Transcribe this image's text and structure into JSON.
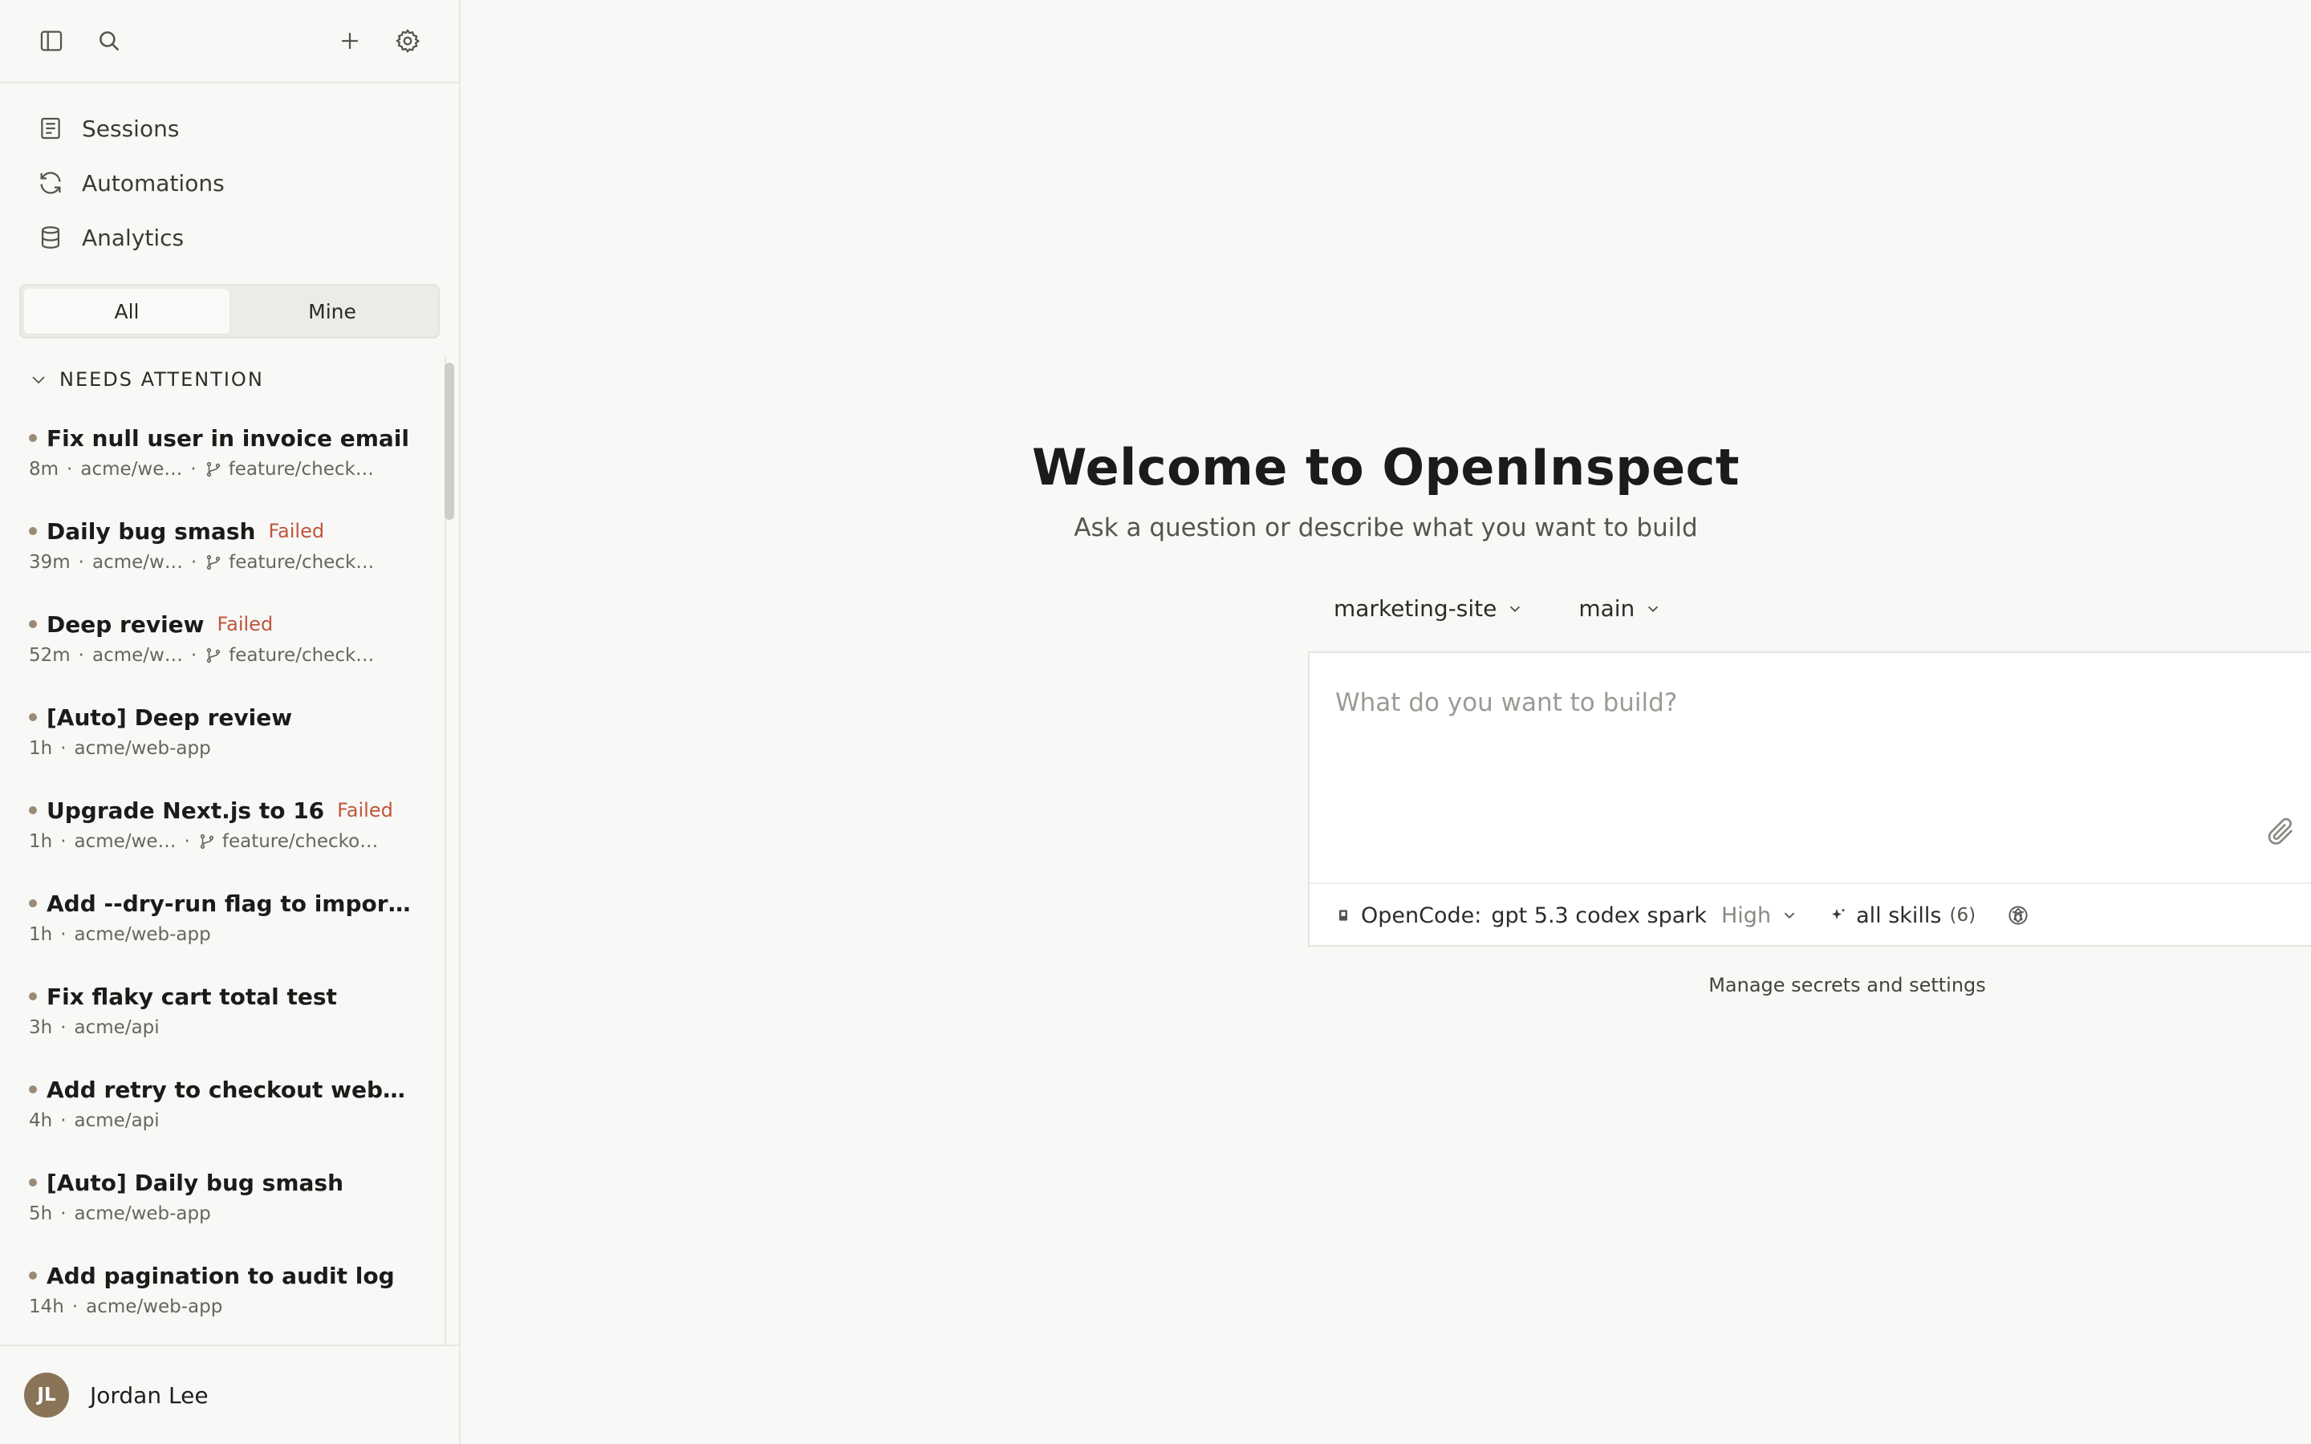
{
  "sidebar": {
    "nav": [
      {
        "label": "Sessions",
        "icon": "document-icon"
      },
      {
        "label": "Automations",
        "icon": "refresh-icon"
      },
      {
        "label": "Analytics",
        "icon": "database-icon"
      }
    ],
    "filter": {
      "all": "All",
      "mine": "Mine",
      "selected": "All"
    },
    "section_title": "NEEDS ATTENTION",
    "sessions": [
      {
        "title": "Fix null user in invoice email",
        "badge": "",
        "time": "8m",
        "repo": "acme/we…",
        "branch": "feature/check…"
      },
      {
        "title": "Daily bug smash",
        "badge": "Failed",
        "time": "39m",
        "repo": "acme/w…",
        "branch": "feature/check…"
      },
      {
        "title": "Deep review",
        "badge": "Failed",
        "time": "52m",
        "repo": "acme/w…",
        "branch": "feature/check…"
      },
      {
        "title": "[Auto] Deep review",
        "badge": "",
        "time": "1h",
        "repo": "acme/web-app",
        "branch": ""
      },
      {
        "title": "Upgrade Next.js to 16",
        "badge": "Failed",
        "time": "1h",
        "repo": "acme/we…",
        "branch": "feature/checko…"
      },
      {
        "title": "Add --dry-run flag to impor…",
        "badge": "",
        "time": "1h",
        "repo": "acme/web-app",
        "branch": ""
      },
      {
        "title": "Fix flaky cart total test",
        "badge": "",
        "time": "3h",
        "repo": "acme/api",
        "branch": ""
      },
      {
        "title": "Add retry to checkout web…",
        "badge": "",
        "time": "4h",
        "repo": "acme/api",
        "branch": ""
      },
      {
        "title": "[Auto] Daily bug smash",
        "badge": "",
        "time": "5h",
        "repo": "acme/web-app",
        "branch": ""
      },
      {
        "title": "Add pagination to audit log",
        "badge": "",
        "time": "14h",
        "repo": "acme/web-app",
        "branch": ""
      }
    ],
    "user": {
      "initials": "JL",
      "name": "Jordan Lee"
    }
  },
  "main": {
    "title": "Welcome to OpenInspect",
    "subtitle": "Ask a question or describe what you want to build",
    "repo": "marketing-site",
    "branch": "main",
    "composer": {
      "placeholder": "What do you want to build?",
      "value": "",
      "model_label": "OpenCode:",
      "model_name": "gpt 5.3 codex spark",
      "model_level": "High",
      "skills_label": "all skills",
      "skills_count": "(6)"
    },
    "manage_link": "Manage secrets and settings"
  },
  "colors": {
    "accent_failed": "#c0563d",
    "avatar_bg": "#8a7458",
    "status_dot": "#9a8a76"
  }
}
